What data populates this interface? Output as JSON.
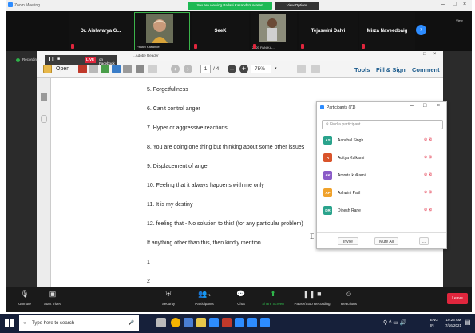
{
  "zoom": {
    "window_title": "Zoom Meeting",
    "viewing_banner": "You are viewing Pallavi Kasande's screen",
    "view_options": "View Options",
    "view_button": "View"
  },
  "thumbnails": [
    {
      "name": "Dr. Aishwarya G...",
      "caption": ""
    },
    {
      "name": "",
      "caption": "Pallavi Kasande"
    },
    {
      "name": "SeeK",
      "caption": ""
    },
    {
      "name": "",
      "caption": "2020 PAN KA..."
    },
    {
      "name": "Tejaswini Dalvi",
      "caption": ""
    },
    {
      "name": "Mirza Naveedbaig",
      "caption": ""
    }
  ],
  "recording": {
    "label": "Recording...",
    "live": "LIVE",
    "platform": "on Facebook"
  },
  "acrobat": {
    "window_title": "...Adobe Reader",
    "open": "Open",
    "page_current": "1",
    "page_total": "/ 4",
    "zoom": "75%",
    "tools": "Tools",
    "fill_sign": "Fill & Sign",
    "comment": "Comment"
  },
  "document": {
    "lines": [
      "5. Forgetfullness",
      "6. Can't control anger",
      "7. Hyper or aggressive reactions",
      "8. You are doing one thing but thinking about some other issues",
      "9. Displacement of anger",
      "10. Feeling that it always happens with me only",
      "11. It is my destiny",
      "12. feeling that - No solution to this! (for any particular problem)",
      "If anything other than this, then kindly mention",
      "1",
      "2"
    ]
  },
  "participants": {
    "title": "Participants (71)",
    "search_placeholder": "Find a participant",
    "list": [
      {
        "initials": "AS",
        "name": "Aanchal Singh",
        "color": "#2aa38c"
      },
      {
        "initials": "A",
        "name": "Aditya Kulkarni",
        "color": "#d9542b"
      },
      {
        "initials": "AK",
        "name": "Amruta kulkarni",
        "color": "#8b5cc8"
      },
      {
        "initials": "AP",
        "name": "Ashwini Patil",
        "color": "#f0a22c"
      },
      {
        "initials": "DR",
        "name": "Dinesh Rane",
        "color": "#2aa38c"
      }
    ],
    "invite": "Invite",
    "mute_all": "Mute All",
    "more": "..."
  },
  "controls": [
    {
      "label": "Unmute",
      "icon": "microphone-muted-icon"
    },
    {
      "label": "Start Video",
      "icon": "video-off-icon"
    },
    {
      "label": "Security",
      "icon": "shield-icon"
    },
    {
      "label": "Participants",
      "icon": "participants-icon"
    },
    {
      "label": "Chat",
      "icon": "chat-icon"
    },
    {
      "label": "Share Screen",
      "icon": "share-screen-icon"
    },
    {
      "label": "Pause/Stop Recording",
      "icon": "pause-recording-icon"
    },
    {
      "label": "Reactions",
      "icon": "reactions-icon"
    }
  ],
  "leave": "Leave",
  "participants_count": "71",
  "taskbar": {
    "search_placeholder": "Type here to search",
    "lang_top": "ENG",
    "lang_bottom": "IN",
    "time": "10:23 AM",
    "date": "7/16/2021"
  }
}
